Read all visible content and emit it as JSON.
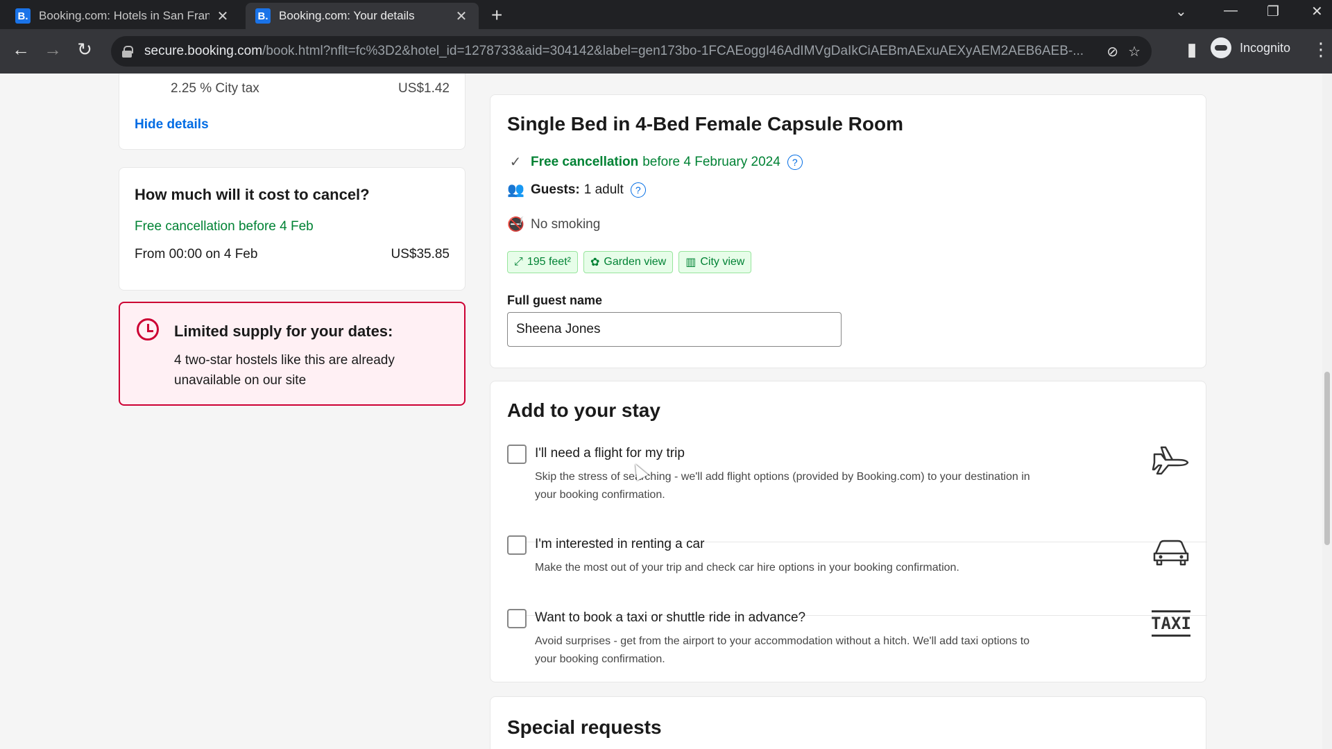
{
  "browser": {
    "tabs": [
      {
        "favicon": "B.",
        "title": "Booking.com: Hotels in San Fran"
      },
      {
        "favicon": "B.",
        "title": "Booking.com: Your details"
      }
    ],
    "url_host": "secure.booking.com",
    "url_path": "/book.html?nflt=fc%3D2&hotel_id=1278733&aid=304142&label=gen173bo-1FCAEoggI46AdIMVgDaIkCiAEBmAExuAEXyAEM2AEB6AEB-...",
    "profile_label": "Incognito"
  },
  "left": {
    "tax_label": "2.25 % City tax",
    "tax_value": "US$1.42",
    "hide_details": "Hide details",
    "cancel_title": "How much will it cost to cancel?",
    "free_cancel": "Free cancellation before 4 Feb",
    "from_label": "From 00:00 on 4 Feb",
    "from_value": "US$35.85",
    "supply_title": "Limited supply for your dates:",
    "supply_text": "4 two-star hostels like this are already unavailable on our site"
  },
  "room": {
    "title": "Single Bed in 4-Bed Female Capsule Room",
    "free_cancel_bold": "Free cancellation",
    "free_cancel_rest": "before 4 February 2024",
    "guests_label": "Guests:",
    "guests_value": "1 adult",
    "smoking": "No smoking",
    "chips": [
      "195 feet²",
      "Garden view",
      "City view"
    ],
    "name_label": "Full guest name",
    "name_value": "Sheena Jones"
  },
  "stay": {
    "title": "Add to your stay",
    "flight_title": "I'll need a flight for my trip",
    "flight_desc": "Skip the stress of searching - we'll add flight options (provided by Booking.com) to your destination in your booking confirmation.",
    "car_title": "I'm interested in renting a car",
    "car_desc": "Make the most out of your trip and check car hire options in your booking confirmation.",
    "taxi_title": "Want to book a taxi or shuttle ride in advance?",
    "taxi_desc": "Avoid surprises - get from the airport to your accommodation without a hitch. We'll add taxi options to your booking confirmation.",
    "taxi_icon_text": "TAXI"
  },
  "special": {
    "title": "Special requests"
  },
  "colors": {
    "brand_blue": "#006ce4",
    "success_green": "#008234",
    "alert_red": "#cc0033"
  }
}
